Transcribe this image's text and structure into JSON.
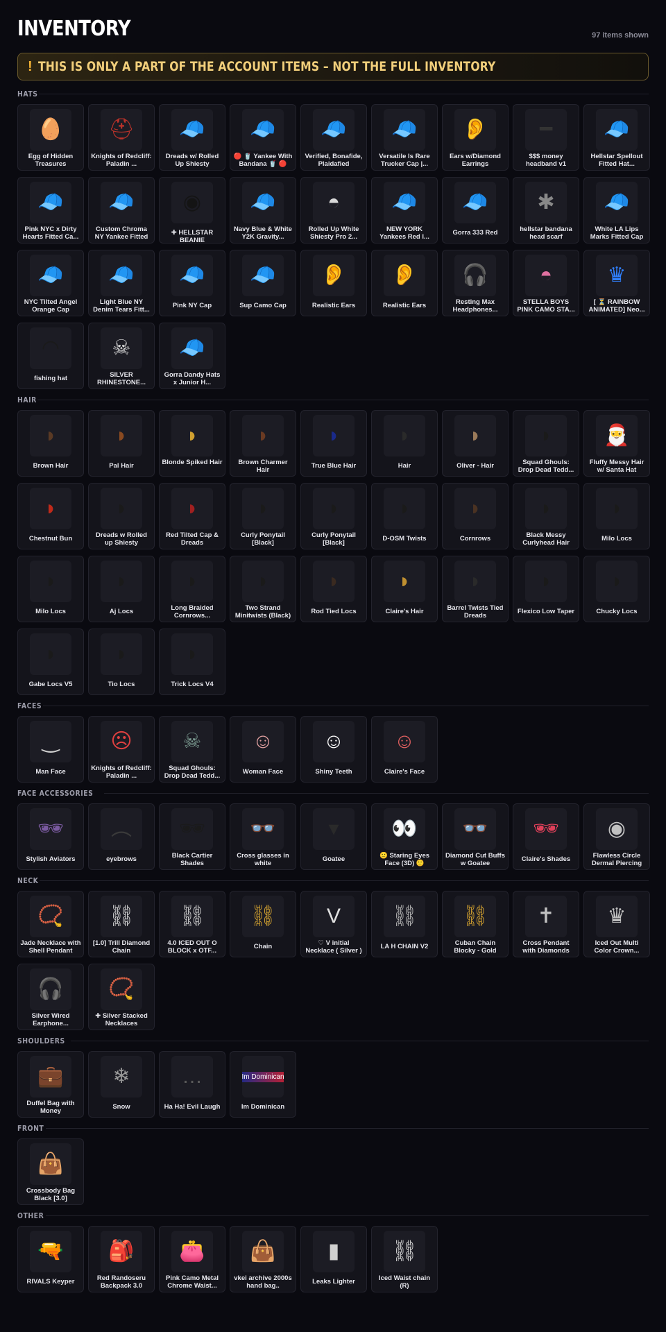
{
  "page": {
    "title": "INVENTORY",
    "count": "97 items shown",
    "banner": "THIS IS ONLY A PART OF THE ACCOUNT ITEMS – NOT THE FULL INVENTORY",
    "banner_icon": "!"
  },
  "colors": {
    "background": "#0a0a10",
    "card": "#14141b",
    "banner_text": "#f2cf7b",
    "banner_border": "#6b5a2c"
  },
  "sections": [
    {
      "label": "HATS",
      "items": [
        {
          "name": "Egg of Hidden Treasures",
          "icon": "egg-hat-icon",
          "glyph": "🥚",
          "color": "#e8b030"
        },
        {
          "name": "Knights of Redcliff: Paladin ...",
          "icon": "helmet-icon",
          "glyph": "⛑",
          "color": "#b8322a"
        },
        {
          "name": "Dreads w/ Rolled Up Shiesty",
          "icon": "beanie-dreads-icon",
          "glyph": "🧢",
          "color": "#222222"
        },
        {
          "name": "🔴 🥤 Yankee With Bandana 🥤 🔴",
          "icon": "red-cap-icon",
          "glyph": "🧢",
          "color": "#d42a2a"
        },
        {
          "name": "Verified, Bonafide, Plaidafied",
          "icon": "plaid-cap-icon",
          "glyph": "🧢",
          "color": "#3f9a5a"
        },
        {
          "name": "Versatile Is Rare Trucker Cap |...",
          "icon": "trucker-cap-icon",
          "glyph": "🧢",
          "color": "#222222"
        },
        {
          "name": "Ears w/Diamond Earrings",
          "icon": "ear-icon",
          "glyph": "👂",
          "color": "#c08060"
        },
        {
          "name": "$$$ money headband v1",
          "icon": "headband-icon",
          "glyph": "━",
          "color": "#333333"
        },
        {
          "name": "Hellstar Spellout Fitted Hat...",
          "icon": "fitted-hat-icon",
          "glyph": "🧢",
          "color": "#1a1a1a"
        },
        {
          "name": "Pink NYC x Dirty Hearts Fitted Ca...",
          "icon": "pink-cap-icon",
          "glyph": "🧢",
          "color": "#e48cb0"
        },
        {
          "name": "Custom Chroma NY Yankee Fitted",
          "icon": "ny-cap-icon",
          "glyph": "🧢",
          "color": "#1a1a1a"
        },
        {
          "name": "✚ HELLSTAR BEANIE",
          "icon": "beanie-icon",
          "glyph": "◉",
          "color": "#141414"
        },
        {
          "name": "Navy Blue & White Y2K Gravity...",
          "icon": "y2k-cap-icon",
          "glyph": "🧢",
          "color": "#f4f4f4"
        },
        {
          "name": "Rolled Up White Shiesty Pro 2...",
          "icon": "white-beanie-icon",
          "glyph": "◓",
          "color": "#d8d8d8"
        },
        {
          "name": "NEW YORK Yankees Red l...",
          "icon": "red-ny-cap-icon",
          "glyph": "🧢",
          "color": "#d42a2a"
        },
        {
          "name": "Gorra 333 Red",
          "icon": "red-cap-icon",
          "glyph": "🧢",
          "color": "#c02020"
        },
        {
          "name": "hellstar bandana head scarf",
          "icon": "bandana-icon",
          "glyph": "✱",
          "color": "#888888"
        },
        {
          "name": "White LA Lips Marks Fitted Cap",
          "icon": "white-cap-icon",
          "glyph": "🧢",
          "color": "#f0f0f0"
        },
        {
          "name": "NYC Tilted Angel Orange Cap",
          "icon": "orange-cap-icon",
          "glyph": "🧢",
          "color": "#e0542a"
        },
        {
          "name": "Light Blue NY Denim Tears Fitt...",
          "icon": "blue-cap-icon",
          "glyph": "🧢",
          "color": "#8ab4e0"
        },
        {
          "name": "Pink NY Cap",
          "icon": "pink-cap-icon",
          "glyph": "🧢",
          "color": "#e890b0"
        },
        {
          "name": "Sup Camo Cap",
          "icon": "camo-cap-icon",
          "glyph": "🧢",
          "color": "#7a6a50"
        },
        {
          "name": "Realistic Ears",
          "icon": "ear-icon",
          "glyph": "👂",
          "color": "#555555"
        },
        {
          "name": "Realistic Ears",
          "icon": "ear-icon",
          "glyph": "👂",
          "color": "#b07040"
        },
        {
          "name": "Resting Max Headphones...",
          "icon": "headphones-icon",
          "glyph": "🎧",
          "color": "#e880b0"
        },
        {
          "name": "STELLA BOYS PINK CAMO STA...",
          "icon": "pink-beanie-icon",
          "glyph": "◓",
          "color": "#e070a0"
        },
        {
          "name": "[ ⏳ RAINBOW ANIMATED] Neo...",
          "icon": "neon-crown-icon",
          "glyph": "♛",
          "color": "#3080ff"
        },
        {
          "name": "fishing hat",
          "icon": "bucket-hat-icon",
          "glyph": "◠",
          "color": "#1a1a1a"
        },
        {
          "name": "SILVER RHINESTONE...",
          "icon": "skull-icon",
          "glyph": "☠",
          "color": "#d8d8d8"
        },
        {
          "name": "Gorra Dandy Hats x Junior H...",
          "icon": "black-cap-icon",
          "glyph": "🧢",
          "color": "#1a1a1a"
        }
      ]
    },
    {
      "label": "HAIR",
      "items": [
        {
          "name": "Brown Hair",
          "icon": "hair-icon",
          "glyph": "◗",
          "color": "#5a3a24"
        },
        {
          "name": "Pal Hair",
          "icon": "hair-icon",
          "glyph": "◗",
          "color": "#8a4a20"
        },
        {
          "name": "Blonde Spiked Hair",
          "icon": "hair-icon",
          "glyph": "◗",
          "color": "#d0a030"
        },
        {
          "name": "Brown Charmer Hair",
          "icon": "hair-icon",
          "glyph": "◗",
          "color": "#6a3a22"
        },
        {
          "name": "True Blue Hair",
          "icon": "hair-icon",
          "glyph": "◗",
          "color": "#1a2a8a"
        },
        {
          "name": "Hair",
          "icon": "hair-icon",
          "glyph": "◗",
          "color": "#2a2a2a"
        },
        {
          "name": "Oliver - Hair",
          "icon": "hair-icon",
          "glyph": "◗",
          "color": "#9a7a5a"
        },
        {
          "name": "Squad Ghouls: Drop Dead Tedd...",
          "icon": "hair-icon",
          "glyph": "◗",
          "color": "#1a1a1a"
        },
        {
          "name": "Fluffy Messy Hair w/ Santa Hat",
          "icon": "santa-hat-icon",
          "glyph": "🎅",
          "color": "#d42a2a"
        },
        {
          "name": "Chestnut Bun",
          "icon": "hair-icon",
          "glyph": "◗",
          "color": "#c02a1a"
        },
        {
          "name": "Dreads w Rolled up Shiesty",
          "icon": "dreads-icon",
          "glyph": "◗",
          "color": "#1a1a1a"
        },
        {
          "name": "Red Tilted Cap & Dreads",
          "icon": "dreads-icon",
          "glyph": "◗",
          "color": "#a02020"
        },
        {
          "name": "Curly Ponytail [Black]",
          "icon": "hair-icon",
          "glyph": "◗",
          "color": "#1a1a1a"
        },
        {
          "name": "Curly Ponytail [Black]",
          "icon": "hair-icon",
          "glyph": "◗",
          "color": "#1a1a1a"
        },
        {
          "name": "D-OSM Twists",
          "icon": "hair-icon",
          "glyph": "◗",
          "color": "#1a1a1a"
        },
        {
          "name": "Cornrows",
          "icon": "hair-icon",
          "glyph": "◗",
          "color": "#4a3222"
        },
        {
          "name": "Black Messy Curlyhead Hair",
          "icon": "hair-icon",
          "glyph": "◗",
          "color": "#1a1a1a"
        },
        {
          "name": "Milo Locs",
          "icon": "hair-icon",
          "glyph": "◗",
          "color": "#1a1a1a"
        },
        {
          "name": "Milo Locs",
          "icon": "hair-icon",
          "glyph": "◗",
          "color": "#1a1a1a"
        },
        {
          "name": "Aj Locs",
          "icon": "hair-icon",
          "glyph": "◗",
          "color": "#1a1a1a"
        },
        {
          "name": "Long Braided Cornrows...",
          "icon": "hair-icon",
          "glyph": "◗",
          "color": "#1a1a1a"
        },
        {
          "name": "Two Strand Minitwists (Black)",
          "icon": "hair-icon",
          "glyph": "◗",
          "color": "#1a1a1a"
        },
        {
          "name": "Rod Tied Locs",
          "icon": "hair-icon",
          "glyph": "◗",
          "color": "#3a2a20"
        },
        {
          "name": "Claire's Hair",
          "icon": "hair-icon",
          "glyph": "◗",
          "color": "#c09030"
        },
        {
          "name": "Barrel Twists Tied Dreads",
          "icon": "hair-icon",
          "glyph": "◗",
          "color": "#2a2a2a"
        },
        {
          "name": "Flexico Low Taper",
          "icon": "hair-icon",
          "glyph": "◗",
          "color": "#1a1a1a"
        },
        {
          "name": "Chucky Locs",
          "icon": "hair-icon",
          "glyph": "◗",
          "color": "#1a1a1a"
        },
        {
          "name": "Gabe Locs V5",
          "icon": "hair-icon",
          "glyph": "◗",
          "color": "#1a1a1a"
        },
        {
          "name": "Tio Locs",
          "icon": "hair-icon",
          "glyph": "◗",
          "color": "#1a1a1a"
        },
        {
          "name": "Trick Locs V4",
          "icon": "hair-icon",
          "glyph": "◗",
          "color": "#1a1a1a"
        }
      ]
    },
    {
      "label": "FACES",
      "items": [
        {
          "name": "Man Face",
          "icon": "face-icon",
          "glyph": "‿",
          "color": "#cfcfcf"
        },
        {
          "name": "Knights of Redcliff: Paladin ...",
          "icon": "face-icon",
          "glyph": "☹",
          "color": "#e04040"
        },
        {
          "name": "Squad Ghouls: Drop Dead Tedd...",
          "icon": "ghoul-face-icon",
          "glyph": "☠",
          "color": "#7a9a90"
        },
        {
          "name": "Woman Face",
          "icon": "face-icon",
          "glyph": "☺",
          "color": "#e0a0a0"
        },
        {
          "name": "Shiny Teeth",
          "icon": "face-icon",
          "glyph": "☺",
          "color": "#ffffff"
        },
        {
          "name": "Claire's Face",
          "icon": "face-icon",
          "glyph": "☺",
          "color": "#e06060"
        }
      ]
    },
    {
      "label": "FACE ACCESSORIES",
      "items": [
        {
          "name": "Stylish Aviators",
          "icon": "sunglasses-icon",
          "glyph": "🕶",
          "color": "#7a5aa0"
        },
        {
          "name": "eyebrows",
          "icon": "eyebrows-icon",
          "glyph": "︵",
          "color": "#3a3a3a"
        },
        {
          "name": "Black Cartier Shades",
          "icon": "sunglasses-icon",
          "glyph": "🕶",
          "color": "#1a1a1a"
        },
        {
          "name": "Cross glasses in white",
          "icon": "glasses-icon",
          "glyph": "👓",
          "color": "#d8d8d8"
        },
        {
          "name": "Goatee",
          "icon": "goatee-icon",
          "glyph": "▾",
          "color": "#2a2a2a"
        },
        {
          "name": "🙂 Staring Eyes Face (3D) 🙂",
          "icon": "eyes-icon",
          "glyph": "👀",
          "color": "#c0a080"
        },
        {
          "name": "Diamond Cut Buffs w Goatee",
          "icon": "glasses-icon",
          "glyph": "👓",
          "color": "#5a5a5a"
        },
        {
          "name": "Claire's Shades",
          "icon": "sunglasses-icon",
          "glyph": "🕶",
          "color": "#e0405a"
        },
        {
          "name": "Flawless Circle Dermal Piercing",
          "icon": "piercing-icon",
          "glyph": "◉",
          "color": "#c0c0c0"
        }
      ]
    },
    {
      "label": "NECK",
      "items": [
        {
          "name": "Jade Necklace with Shell Pendant",
          "icon": "necklace-icon",
          "glyph": "📿",
          "color": "#40a080"
        },
        {
          "name": "[1.0] Trill Diamond Chain",
          "icon": "chain-icon",
          "glyph": "⛓",
          "color": "#d0d0d0"
        },
        {
          "name": "4.0 ICED OUT O BLOCK x OTF...",
          "icon": "chain-icon",
          "glyph": "⛓",
          "color": "#d0d0d0"
        },
        {
          "name": "Chain",
          "icon": "chain-icon",
          "glyph": "⛓",
          "color": "#d0a030"
        },
        {
          "name": "♡ V initial Necklace ( Silver )",
          "icon": "necklace-icon",
          "glyph": "V",
          "color": "#e0e0e0"
        },
        {
          "name": "LA H CHAIN V2",
          "icon": "chain-icon",
          "glyph": "⛓",
          "color": "#b0b0b0"
        },
        {
          "name": "Cuban Chain Blocky - Gold",
          "icon": "chain-icon",
          "glyph": "⛓",
          "color": "#d0a030"
        },
        {
          "name": "Cross Pendant with Diamonds",
          "icon": "cross-pendant-icon",
          "glyph": "✝",
          "color": "#c0c0c0"
        },
        {
          "name": "Iced Out Multi Color Crown...",
          "icon": "crown-pendant-icon",
          "glyph": "♛",
          "color": "#c0c0c0"
        },
        {
          "name": "Silver Wired Earphone...",
          "icon": "earphones-icon",
          "glyph": "🎧",
          "color": "#c0c0c0"
        },
        {
          "name": "✚ Silver Stacked Necklaces",
          "icon": "necklace-icon",
          "glyph": "📿",
          "color": "#b0b0b0"
        }
      ]
    },
    {
      "label": "SHOULDERS",
      "items": [
        {
          "name": "Duffel Bag with Money",
          "icon": "duffel-bag-icon",
          "glyph": "💼",
          "color": "#2a2a2a"
        },
        {
          "name": "Snow",
          "icon": "snow-icon",
          "glyph": "❄",
          "color": "#9a9a9a"
        },
        {
          "name": "Ha Ha! Evil Laugh",
          "icon": "laugh-icon",
          "glyph": "…",
          "color": "#5a5a5a"
        },
        {
          "name": "Im Dominican",
          "icon": "flag-icon",
          "glyph": "⚑",
          "color": "#c02030",
          "badge": "Im Dominican"
        }
      ]
    },
    {
      "label": "FRONT",
      "items": [
        {
          "name": "Crossbody Bag Black [3.0]",
          "icon": "bag-icon",
          "glyph": "👜",
          "color": "#1a1a1a"
        }
      ]
    },
    {
      "label": "OTHER",
      "items": [
        {
          "name": "RIVALS Keyper",
          "icon": "rifle-icon",
          "glyph": "🔫",
          "color": "#d0a030"
        },
        {
          "name": "Red Randoseru Backpack 3.0",
          "icon": "backpack-icon",
          "glyph": "🎒",
          "color": "#e02020"
        },
        {
          "name": "Pink Camo Metal Chrome Waist...",
          "icon": "waist-bag-icon",
          "glyph": "👛",
          "color": "#8a8a8a"
        },
        {
          "name": "vkei archive 2000s hand bag..",
          "icon": "handbag-icon",
          "glyph": "👜",
          "color": "#8a8a8a"
        },
        {
          "name": "Leaks Lighter",
          "icon": "lighter-icon",
          "glyph": "▮",
          "color": "#d0d0d0"
        },
        {
          "name": "Iced Waist chain (R)",
          "icon": "waist-chain-icon",
          "glyph": "⛓",
          "color": "#d0d0d0"
        }
      ]
    }
  ]
}
